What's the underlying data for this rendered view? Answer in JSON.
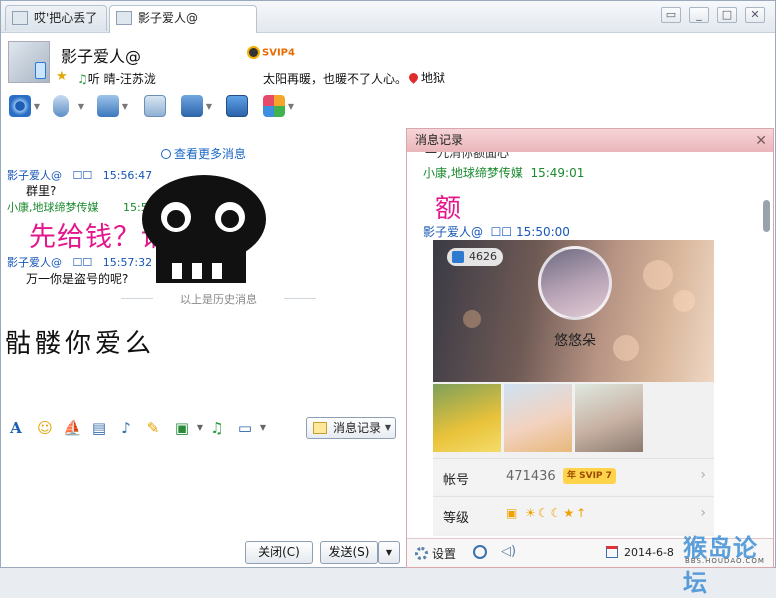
{
  "tabs": [
    {
      "label": "哎'把心丢了",
      "active": false
    },
    {
      "label": "影子爱人@",
      "active": true
    }
  ],
  "header": {
    "name": "影子爱人@",
    "vip_badge": "SVIP4",
    "music": "听 晴-汪苏泷",
    "signature": "太阳再暖，也暖不了人心。",
    "location": "地狱"
  },
  "chat": {
    "more_messages": "查看更多消息",
    "messages": [
      {
        "sender": "影子爱人@",
        "mark": "☐☐",
        "time": "15:56:47",
        "text": "群里?"
      },
      {
        "sender": "小康,地球缔梦传媒",
        "time": "15:57:01",
        "text": "先给钱？谁信啊"
      },
      {
        "sender": "影子爱人@",
        "mark": "☐☐",
        "time": "15:57:32",
        "text": "万一你是盗号的呢?"
      }
    ],
    "history_divider": "以上是历史消息",
    "input_text": "骷髅你爱么"
  },
  "format_bar": {
    "history_button": "消息记录"
  },
  "buttons": {
    "close": "关闭(C)",
    "send": "发送(S)"
  },
  "history_panel": {
    "title": "消息记录",
    "cut_text": "一九消你额面心",
    "entries": [
      {
        "sender": "小康,地球缔梦传媒",
        "time": "15:49:01",
        "text": "额"
      },
      {
        "sender": "影子爱人@",
        "mark": "☐☐",
        "time": "15:50:00"
      }
    ],
    "card": {
      "likes": "4626",
      "nickname": "悠悠朵",
      "account_label": "帐号",
      "account_value": "471436",
      "account_badge": "年 SVIP 7",
      "level_label": "等级"
    },
    "footer": {
      "settings": "设置",
      "date": "2014-6-8"
    }
  },
  "watermark": {
    "text": "猴岛论坛",
    "sub": "BBS.HOUDAO.COM"
  }
}
